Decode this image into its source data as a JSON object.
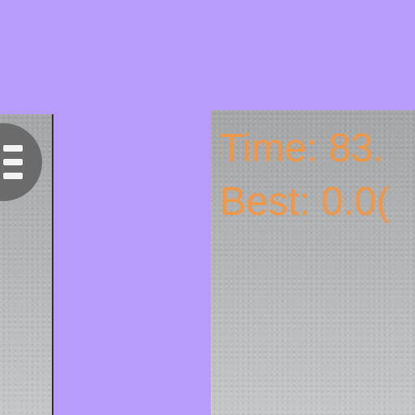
{
  "theme": {
    "background": "#b89cfb",
    "panel": "#b2b4b6",
    "accent": "#f19748",
    "menu_button": "#6b6b6b"
  },
  "menu": {
    "icon": "hamburger-menu-icon"
  },
  "stats": {
    "time_label": "Time:",
    "time_value": "83.",
    "best_label": "Best:",
    "best_value": "0.0("
  }
}
